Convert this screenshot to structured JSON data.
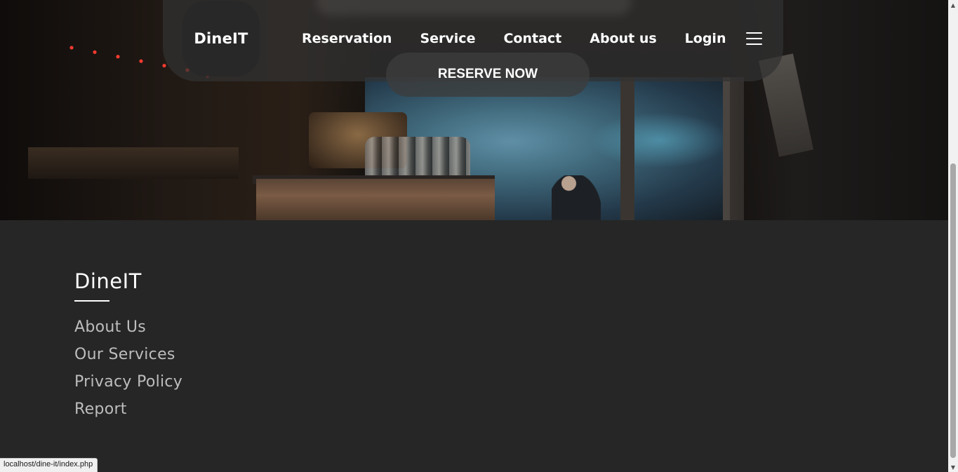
{
  "navbar": {
    "logo": "DineIT",
    "links": [
      "Reservation",
      "Service",
      "Contact",
      "About us",
      "Login"
    ],
    "menu_icon": "hamburger-menu-icon",
    "reserve_label": "RESERVE NOW"
  },
  "footer": {
    "brand": "DineIT",
    "links": [
      "About Us",
      "Our Services",
      "Privacy Policy",
      "Report"
    ]
  },
  "status_bar": {
    "url": "localhost/dine-it/index.php"
  },
  "colors": {
    "footer_bg": "#262626",
    "footer_link": "#bdbdbd",
    "nav_text": "#ffffff"
  }
}
